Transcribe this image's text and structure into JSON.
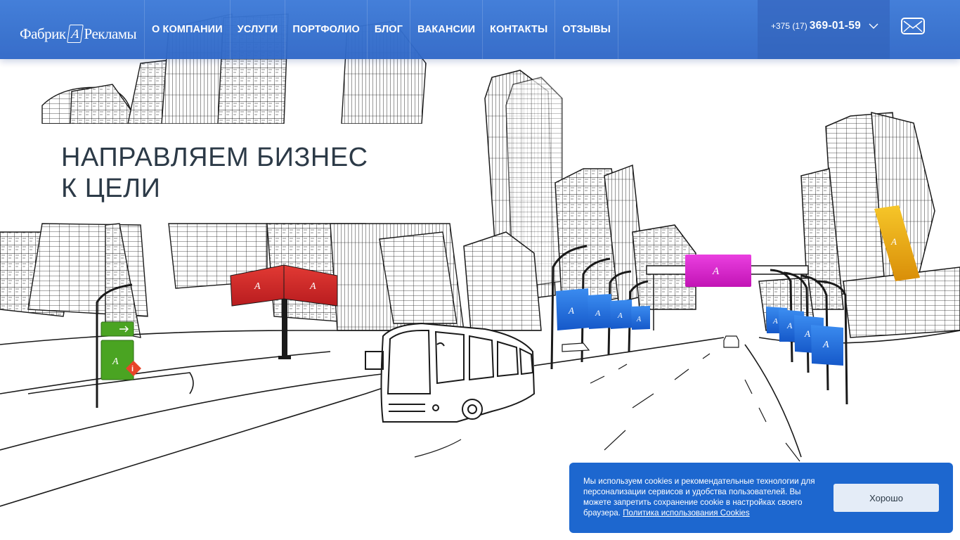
{
  "header": {
    "logo_left": "Фабрик",
    "logo_mark": "А",
    "logo_right": "Рекламы",
    "nav": [
      {
        "label": "О компании"
      },
      {
        "label": "Услуги"
      },
      {
        "label": "Портфолио"
      },
      {
        "label": "Блог"
      },
      {
        "label": "Вакансии"
      },
      {
        "label": "Контакты"
      },
      {
        "label": "Отзывы"
      }
    ],
    "phone_prefix": "+375 (17)",
    "phone_number": "369-01-59"
  },
  "hero": {
    "line1": "Направляем бизнес",
    "line2": "к цели",
    "sign_mark": "А",
    "sign_info": "i"
  },
  "cookie": {
    "text": "Мы используем cookies и рекомендательные технологии для персонализации сервисов и удобства пользователей. Вы можете запретить сохранение cookie в настройках своего браузера.",
    "link": "Политика использования Cookies",
    "button": "Хорошо"
  },
  "colors": {
    "header": "#3d7ad8",
    "cookie_bg": "#1d67cf",
    "billboard_red": "#d42a2a",
    "billboard_magenta": "#d81fc9",
    "flag_blue": "#1f6fe0",
    "sign_green": "#4aa422",
    "banner_yellow": "#f0b419",
    "headline_text": "#2c3a47"
  }
}
